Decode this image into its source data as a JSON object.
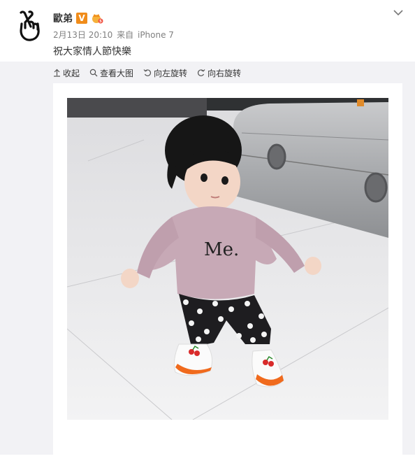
{
  "user": {
    "name": "歐弟",
    "verified_badge": "V"
  },
  "post": {
    "date": "2月13日 20:10",
    "source_prefix": "来自",
    "source": "iPhone 7",
    "text": "祝大家情人節快樂"
  },
  "toolbar": [
    {
      "icon": "collapse-arrow-icon",
      "label": "收起"
    },
    {
      "icon": "magnifier-icon",
      "label": "查看大图"
    },
    {
      "icon": "rotate-left-icon",
      "label": "向左旋转"
    },
    {
      "icon": "rotate-right-icon",
      "label": "向右旋转"
    }
  ],
  "photo": {
    "shirt_text": "Me."
  },
  "colors": {
    "accent": "#f08c1a",
    "bg": "#f2f2f5",
    "meta": "#808080"
  }
}
